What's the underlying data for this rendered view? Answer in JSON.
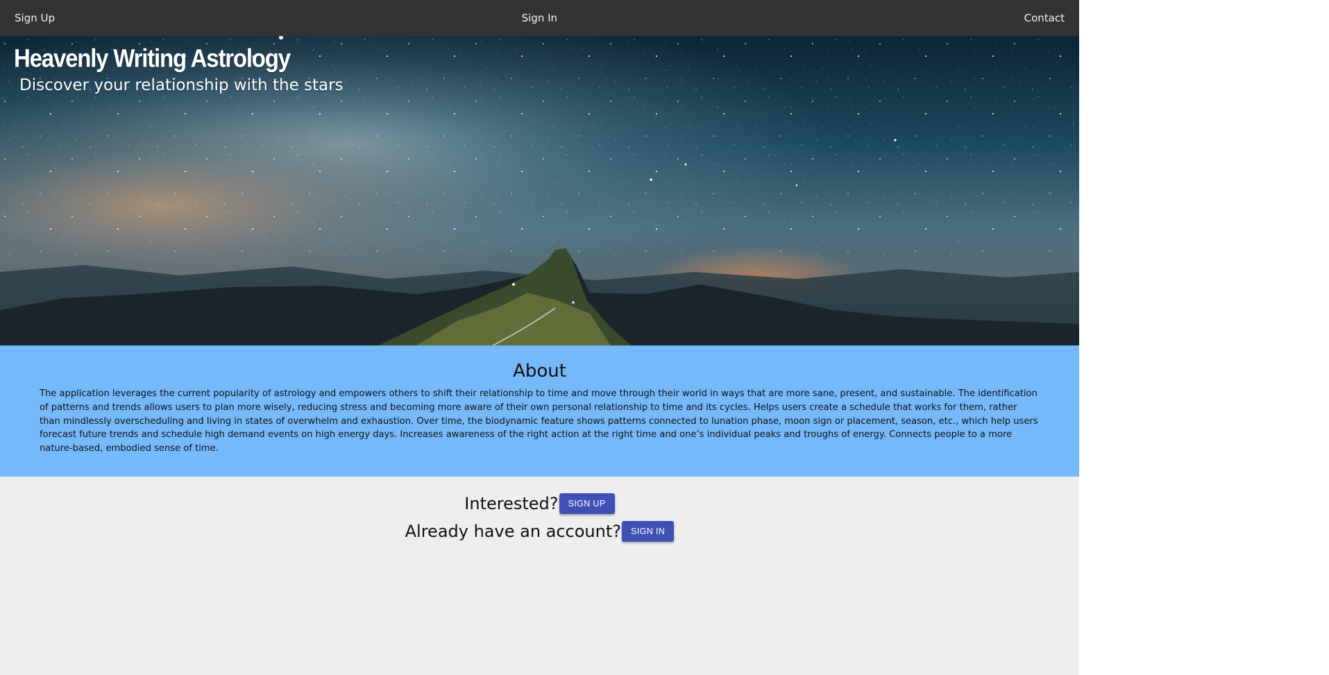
{
  "nav": {
    "sign_up": "Sign Up",
    "sign_in": "Sign In",
    "contact": "Contact"
  },
  "hero": {
    "title": "Heavenly Writing Astrology",
    "subtitle": "Discover your relationship with the stars"
  },
  "about": {
    "heading": "About",
    "body": "The application leverages the current popularity of astrology and empowers others to shift their relationship to time and move through their world in ways that are more sane, present, and sustainable. The identification of patterns and trends allows users to plan more wisely, reducing stress and becoming more aware of their own personal relationship to time and its cycles. Helps users create a schedule that works for them, rather than mindlessly overscheduling and living in states of overwhelm and exhaustion. Over time, the biodynamic feature shows patterns connected to lunation phase, moon sign or placement, season, etc., which help users forecast future trends and schedule high demand events on high energy days. Increases awareness of the right action at the right time and one’s individual peaks and troughs of energy. Connects people to a more nature-based, embodied sense of time."
  },
  "cta": {
    "interested_text": "Interested?",
    "sign_up_button": "SIGN UP",
    "account_text": "Already have an account?",
    "sign_in_button": "SIGN IN"
  },
  "colors": {
    "navbar_bg": "#333333",
    "about_bg": "#75b9fb",
    "cta_bg": "#eeeeee",
    "button_bg": "#3f51b5"
  }
}
